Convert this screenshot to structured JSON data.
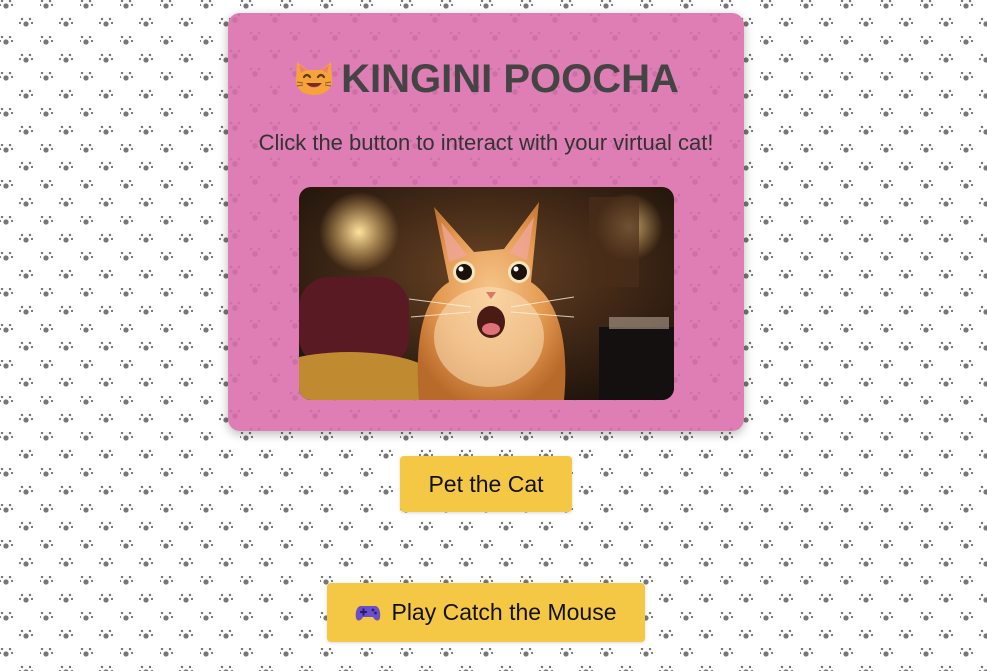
{
  "app": {
    "title": "KINGINI POOCHA",
    "title_icon": "smiling-cat-emoji",
    "subtitle": "Click the button to interact with your virtual cat!"
  },
  "cat_image": {
    "description_icon": "surprised-orange-cat-photo",
    "alt": "Virtual cat"
  },
  "buttons": {
    "pet_label": "Pet the Cat",
    "play_label": "Play Catch the Mouse",
    "play_icon": "gamepad-icon"
  },
  "colors": {
    "card_background": "#de7eb5",
    "button_background": "#f4c745",
    "title_text": "#444444"
  }
}
